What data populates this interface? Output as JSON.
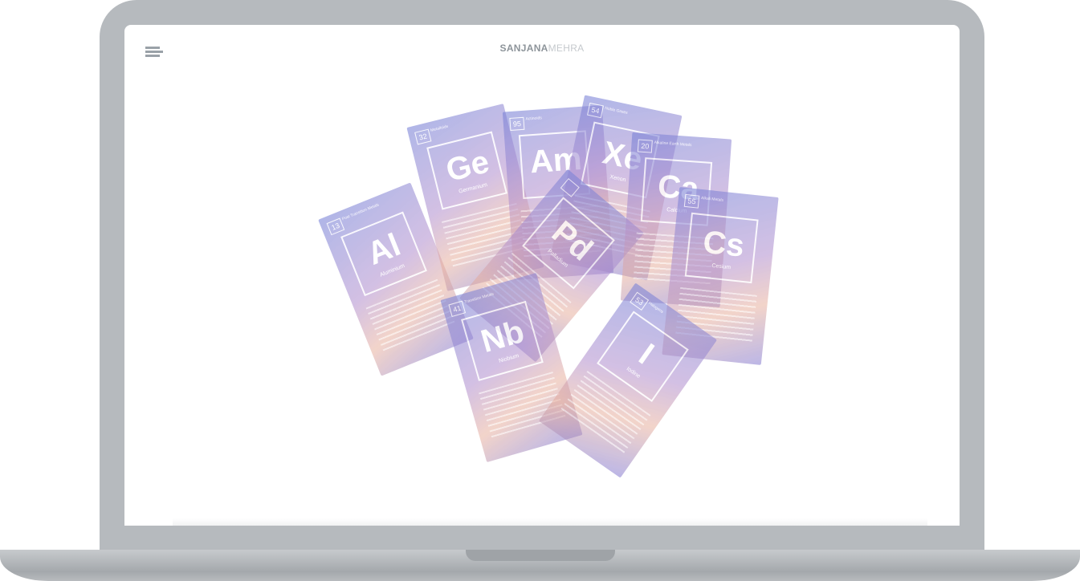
{
  "brand": {
    "bold": "SANJANA",
    "thin": "MEHRA"
  },
  "icons": {
    "menu": "hamburger-menu-icon"
  },
  "colors": {
    "bezel": "#b6babe",
    "screen": "#ffffff",
    "brand_text": "#8d949a",
    "card_accent": "#8c86d8"
  },
  "cards": [
    {
      "number": "13",
      "category": "Post Transition Metals",
      "symbol": "Al",
      "name": "Aluminium"
    },
    {
      "number": "32",
      "category": "Metalloids",
      "symbol": "Ge",
      "name": "Germanium"
    },
    {
      "number": "95",
      "category": "Actinoids",
      "symbol": "Am",
      "name": ""
    },
    {
      "number": "54",
      "category": "Noble Gases",
      "symbol": "Xe",
      "name": "Xenon"
    },
    {
      "number": "20",
      "category": "Alkaline Earth Metals",
      "symbol": "Ca",
      "name": "Calcium"
    },
    {
      "number": "55",
      "category": "Alkali Metals",
      "symbol": "Cs",
      "name": "Cesium"
    },
    {
      "number": "",
      "category": "",
      "symbol": "Pd",
      "name": "Palladium"
    },
    {
      "number": "41",
      "category": "Transition Metals",
      "symbol": "Nb",
      "name": "Niobium"
    },
    {
      "number": "53",
      "category": "Halogens",
      "symbol": "I",
      "name": "Iodine"
    }
  ]
}
